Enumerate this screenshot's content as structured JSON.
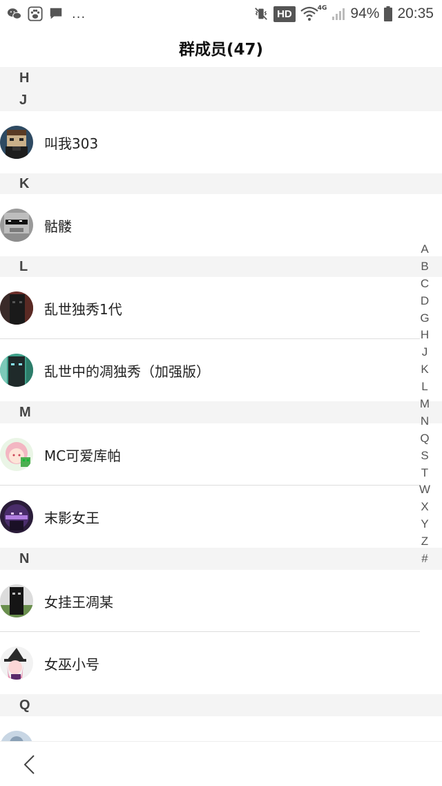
{
  "status_bar": {
    "left_icons": [
      "wechat-icon",
      "baidu-paw-icon",
      "message-icon"
    ],
    "more": "...",
    "hd": "HD",
    "network": "4G",
    "battery": "94%",
    "time": "20:35"
  },
  "title": "群成员(47)",
  "sections": [
    {
      "letter": "H",
      "members": []
    },
    {
      "letter": "J",
      "members": [
        {
          "name": "叫我303"
        }
      ]
    },
    {
      "letter": "K",
      "members": [
        {
          "name": "骷髅"
        }
      ]
    },
    {
      "letter": "L",
      "members": [
        {
          "name": "乱世独秀1代"
        },
        {
          "name": "乱世中的凋独秀（加强版）"
        }
      ]
    },
    {
      "letter": "M",
      "members": [
        {
          "name": "MC可爱库帕"
        },
        {
          "name": "末影女王"
        }
      ]
    },
    {
      "letter": "N",
      "members": [
        {
          "name": "女挂王凋某"
        },
        {
          "name": "女巫小号"
        }
      ]
    },
    {
      "letter": "Q",
      "members": []
    }
  ],
  "alphabet": [
    "A",
    "B",
    "C",
    "D",
    "G",
    "H",
    "J",
    "K",
    "L",
    "M",
    "N",
    "Q",
    "S",
    "T",
    "W",
    "X",
    "Y",
    "Z",
    "#"
  ],
  "colors": {
    "section_bg": "#f4f4f4",
    "divider": "#dddddd"
  }
}
